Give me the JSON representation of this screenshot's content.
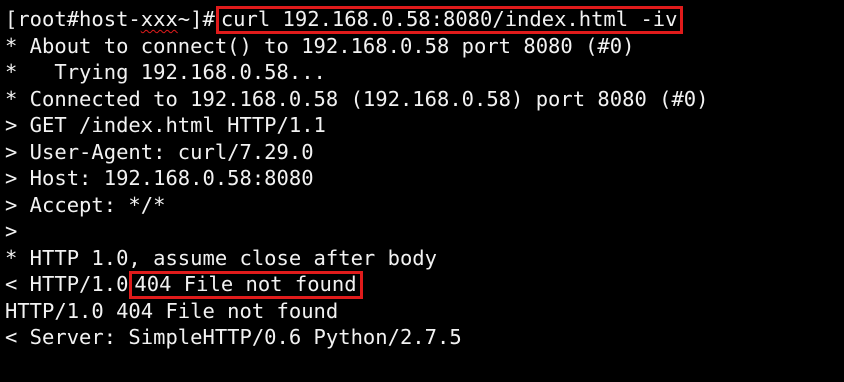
{
  "terminal": {
    "prompt": {
      "open": "[root#host-",
      "host": "xxx",
      "close": "~]#"
    },
    "command": "curl 192.168.0.58:8080/index.html -iv",
    "lines": [
      "* About to connect() to 192.168.0.58 port 8080 (#0)",
      "*   Trying 192.168.0.58...",
      "* Connected to 192.168.0.58 (192.168.0.58) port 8080 (#0)",
      "> GET /index.html HTTP/1.1",
      "> User-Agent: curl/7.29.0",
      "> Host: 192.168.0.58:8080",
      "> Accept: */*",
      ">",
      "* HTTP 1.0, assume close after body"
    ],
    "status_line": {
      "prefix": "< HTTP/1.0",
      "status": "404 File not found"
    },
    "tail_lines": [
      "HTTP/1.0 404 File not found",
      "< Server: SimpleHTTP/0.6 Python/2.7.5"
    ],
    "colors": {
      "background": "#000000",
      "text": "#f2f2f2",
      "highlight_box": "#e01b1b"
    }
  }
}
